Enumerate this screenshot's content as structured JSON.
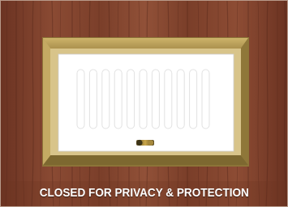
{
  "caption": "CLOSED FOR PRIVACY & PROTECTION",
  "colors": {
    "wood_base": "#8a4a33",
    "wood_dark": "#6b3322",
    "frame_outer": "#c2a85e",
    "frame_inner": "#9a8244",
    "panel": "#ffffff",
    "slats": "#ececec",
    "caption_text": "#ffffff"
  },
  "icons": {
    "knob": "door-knob-icon"
  }
}
